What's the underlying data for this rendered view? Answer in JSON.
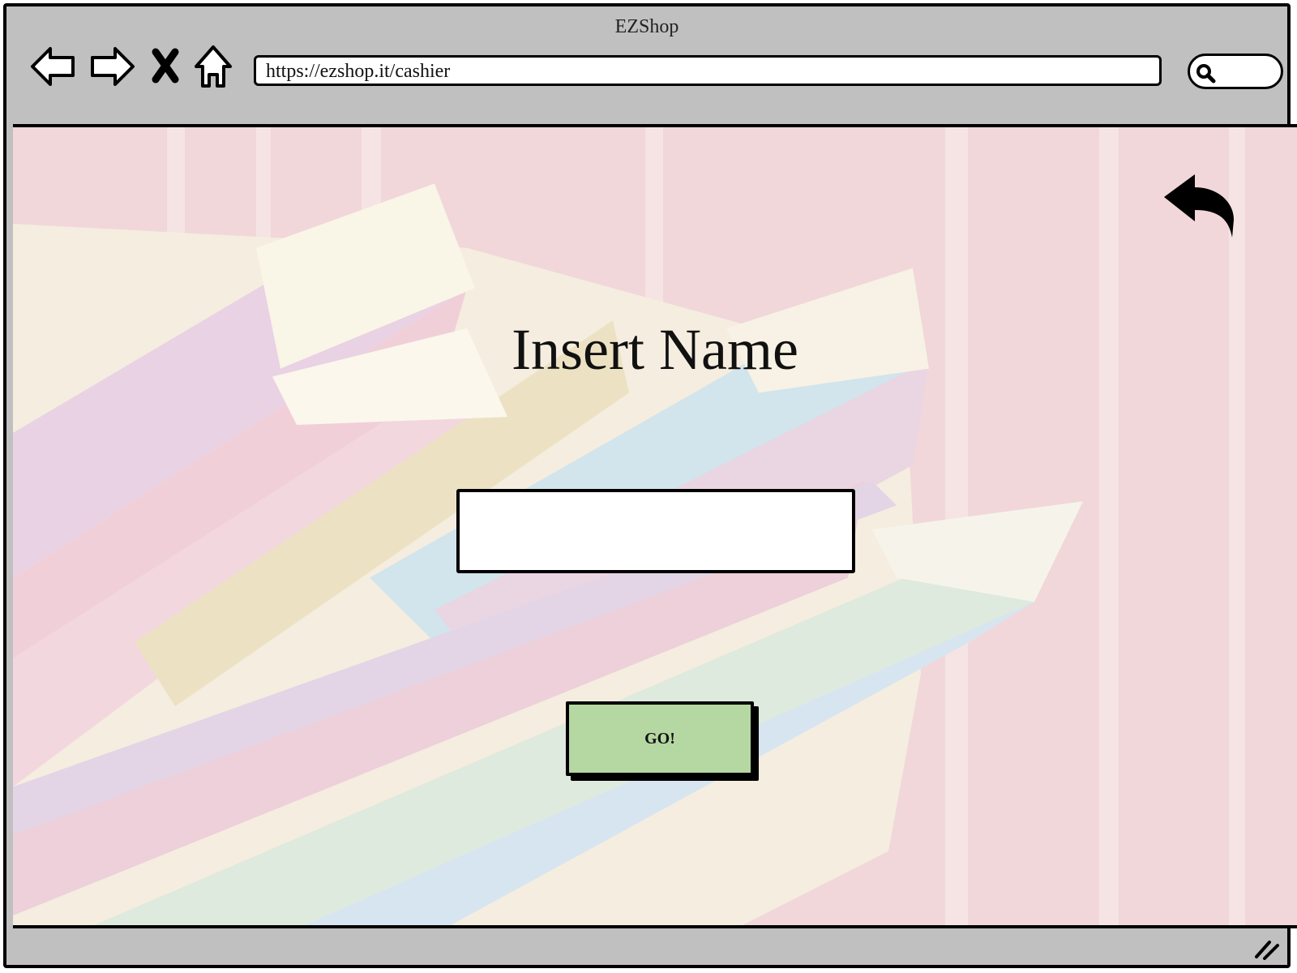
{
  "browser": {
    "title": "EZShop",
    "url": "https://ezshop.it/cashier"
  },
  "toolbar": {
    "icons": [
      "back-arrow-icon",
      "forward-arrow-icon",
      "close-icon",
      "home-icon",
      "search-icon"
    ]
  },
  "main": {
    "heading": "Insert Name",
    "name_input": {
      "value": "",
      "placeholder": ""
    },
    "go_button_label": "GO!",
    "back_icon": "undo-arrow-icon"
  },
  "colors": {
    "chrome": "#c0c0c0",
    "button_green": "#b5d7a2",
    "background_pink": "#eecfd1"
  }
}
